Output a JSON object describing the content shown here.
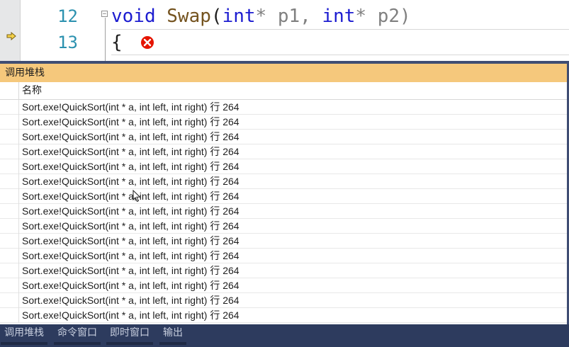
{
  "editor": {
    "lines": [
      {
        "number": "12",
        "keyword": "void",
        "func": "Swap",
        "params_open": "(",
        "t1": "int",
        "p1": "* p1, ",
        "t2": "int",
        "p2": "* p2)"
      },
      {
        "number": "13",
        "text": "{"
      }
    ],
    "collapse_glyph": "−"
  },
  "call_stack": {
    "title": "调用堆栈",
    "column_header": "名称",
    "rows": [
      "Sort.exe!QuickSort(int * a, int left, int right) 行 264",
      "Sort.exe!QuickSort(int * a, int left, int right) 行 264",
      "Sort.exe!QuickSort(int * a, int left, int right) 行 264",
      "Sort.exe!QuickSort(int * a, int left, int right) 行 264",
      "Sort.exe!QuickSort(int * a, int left, int right) 行 264",
      "Sort.exe!QuickSort(int * a, int left, int right) 行 264",
      "Sort.exe!QuickSort(int * a, int left, int right) 行 264",
      "Sort.exe!QuickSort(int * a, int left, int right) 行 264",
      "Sort.exe!QuickSort(int * a, int left, int right) 行 264",
      "Sort.exe!QuickSort(int * a, int left, int right) 行 264",
      "Sort.exe!QuickSort(int * a, int left, int right) 行 264",
      "Sort.exe!QuickSort(int * a, int left, int right) 行 264",
      "Sort.exe!QuickSort(int * a, int left, int right) 行 264",
      "Sort.exe!QuickSort(int * a, int left, int right) 行 264",
      "Sort.exe!QuickSort(int * a, int left, int right) 行 264"
    ]
  },
  "bottom_tabs": [
    "调用堆栈",
    "命令窗口",
    "即时窗口",
    "输出"
  ],
  "colors": {
    "title_bar": "#f5c87c",
    "tab_bar": "#2d3b5e",
    "line_number": "#2b91af",
    "keyword": "#1c1cd0",
    "error": "#e51400"
  },
  "icons": {
    "current_line": "arrow-right-icon",
    "breakpoint_error": "error-x-icon",
    "mouse_cursor": "mouse-cursor-icon"
  }
}
